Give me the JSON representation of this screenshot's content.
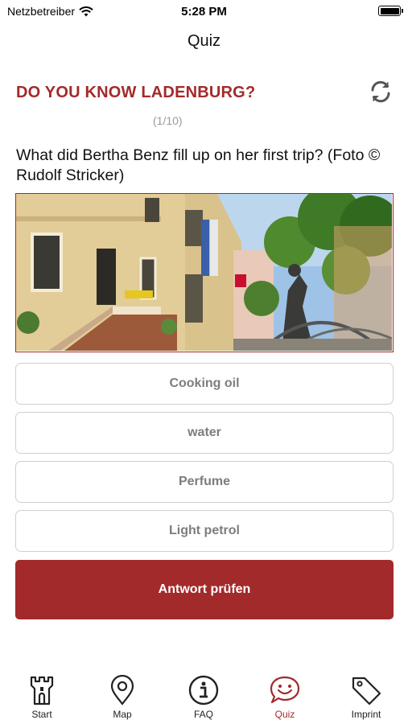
{
  "status_bar": {
    "carrier": "Netzbetreiber",
    "time": "5:28 PM"
  },
  "nav": {
    "title": "Quiz"
  },
  "quiz": {
    "heading": "DO YOU KNOW LADENBURG?",
    "progress": "(1/10)",
    "question": "What did Bertha Benz fill up on her first trip? (Foto © Rudolf Stricker)",
    "answers": [
      "Cooking oil",
      "water",
      "Perfume",
      "Light petrol"
    ],
    "check_label": "Antwort prüfen"
  },
  "tabs": [
    {
      "label": "Start",
      "icon": "tower-icon"
    },
    {
      "label": "Map",
      "icon": "map-pin-icon"
    },
    {
      "label": "FAQ",
      "icon": "info-icon"
    },
    {
      "label": "Quiz",
      "icon": "smiley-chat-icon",
      "active": true
    },
    {
      "label": "Imprint",
      "icon": "tag-icon"
    }
  ],
  "colors": {
    "accent": "#a32a2b",
    "answer_text": "#7d7d7d",
    "answer_border": "#cfcfcf"
  }
}
